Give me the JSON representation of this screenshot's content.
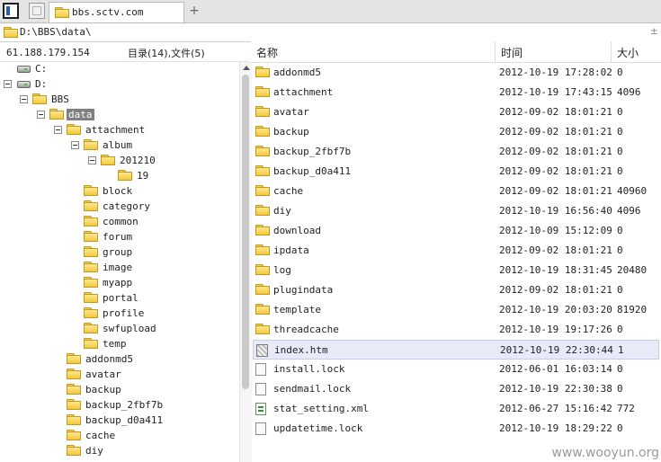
{
  "tab": {
    "title": "bbs.sctv.com"
  },
  "address": {
    "path": "D:\\BBS\\data\\"
  },
  "left_status": {
    "ip": "61.188.179.154",
    "counts": "目录(14),文件(5)"
  },
  "tree": [
    {
      "label": "C:",
      "kind": "drive",
      "level": 0,
      "box": false
    },
    {
      "label": "D:",
      "kind": "drive",
      "level": 0,
      "box": true
    },
    {
      "label": "BBS",
      "kind": "folder",
      "level": 1,
      "box": true
    },
    {
      "label": "data",
      "kind": "folder",
      "level": 2,
      "box": true,
      "selected": true
    },
    {
      "label": "attachment",
      "kind": "folder",
      "level": 3,
      "box": true
    },
    {
      "label": "album",
      "kind": "folder",
      "level": 4,
      "box": true
    },
    {
      "label": "201210",
      "kind": "folder",
      "level": 5,
      "box": true
    },
    {
      "label": "19",
      "kind": "folder",
      "level": 6,
      "box": false
    },
    {
      "label": "block",
      "kind": "folder",
      "level": 4,
      "box": false
    },
    {
      "label": "category",
      "kind": "folder",
      "level": 4,
      "box": false
    },
    {
      "label": "common",
      "kind": "folder",
      "level": 4,
      "box": false
    },
    {
      "label": "forum",
      "kind": "folder",
      "level": 4,
      "box": false
    },
    {
      "label": "group",
      "kind": "folder",
      "level": 4,
      "box": false
    },
    {
      "label": "image",
      "kind": "folder",
      "level": 4,
      "box": false
    },
    {
      "label": "myapp",
      "kind": "folder",
      "level": 4,
      "box": false
    },
    {
      "label": "portal",
      "kind": "folder",
      "level": 4,
      "box": false
    },
    {
      "label": "profile",
      "kind": "folder",
      "level": 4,
      "box": false
    },
    {
      "label": "swfupload",
      "kind": "folder",
      "level": 4,
      "box": false
    },
    {
      "label": "temp",
      "kind": "folder",
      "level": 4,
      "box": false
    },
    {
      "label": "addonmd5",
      "kind": "folder",
      "level": 3,
      "box": false
    },
    {
      "label": "avatar",
      "kind": "folder",
      "level": 3,
      "box": false
    },
    {
      "label": "backup",
      "kind": "folder",
      "level": 3,
      "box": false
    },
    {
      "label": "backup_2fbf7b",
      "kind": "folder",
      "level": 3,
      "box": false
    },
    {
      "label": "backup_d0a411",
      "kind": "folder",
      "level": 3,
      "box": false
    },
    {
      "label": "cache",
      "kind": "folder",
      "level": 3,
      "box": false
    },
    {
      "label": "diy",
      "kind": "folder",
      "level": 3,
      "box": false
    }
  ],
  "list_header": {
    "name": "名称",
    "time": "时间",
    "size": "大小"
  },
  "files": [
    {
      "name": "addonmd5",
      "time": "2012-10-19 17:28:02",
      "size": "0",
      "type": "folder"
    },
    {
      "name": "attachment",
      "time": "2012-10-19 17:43:15",
      "size": "4096",
      "type": "folder"
    },
    {
      "name": "avatar",
      "time": "2012-09-02 18:01:21",
      "size": "0",
      "type": "folder"
    },
    {
      "name": "backup",
      "time": "2012-09-02 18:01:21",
      "size": "0",
      "type": "folder"
    },
    {
      "name": "backup_2fbf7b",
      "time": "2012-09-02 18:01:21",
      "size": "0",
      "type": "folder"
    },
    {
      "name": "backup_d0a411",
      "time": "2012-09-02 18:01:21",
      "size": "0",
      "type": "folder"
    },
    {
      "name": "cache",
      "time": "2012-09-02 18:01:21",
      "size": "40960",
      "type": "folder"
    },
    {
      "name": "diy",
      "time": "2012-10-19 16:56:40",
      "size": "4096",
      "type": "folder"
    },
    {
      "name": "download",
      "time": "2012-10-09 15:12:09",
      "size": "0",
      "type": "folder"
    },
    {
      "name": "ipdata",
      "time": "2012-09-02 18:01:21",
      "size": "0",
      "type": "folder"
    },
    {
      "name": "log",
      "time": "2012-10-19 18:31:45",
      "size": "20480",
      "type": "folder"
    },
    {
      "name": "plugindata",
      "time": "2012-09-02 18:01:21",
      "size": "0",
      "type": "folder"
    },
    {
      "name": "template",
      "time": "2012-10-19 20:03:20",
      "size": "81920",
      "type": "folder"
    },
    {
      "name": "threadcache",
      "time": "2012-10-19 19:17:26",
      "size": "0",
      "type": "folder"
    },
    {
      "name": "index.htm",
      "time": "2012-10-19 22:30:44",
      "size": "1",
      "type": "htm",
      "selected": true
    },
    {
      "name": "install.lock",
      "time": "2012-06-01 16:03:14",
      "size": "0",
      "type": "file"
    },
    {
      "name": "sendmail.lock",
      "time": "2012-10-19 22:30:38",
      "size": "0",
      "type": "file"
    },
    {
      "name": "stat_setting.xml",
      "time": "2012-06-27 15:16:42",
      "size": "772",
      "type": "xml"
    },
    {
      "name": "updatetime.lock",
      "time": "2012-10-19 18:29:22",
      "size": "0",
      "type": "file"
    }
  ],
  "watermark": "www.wooyun.org"
}
